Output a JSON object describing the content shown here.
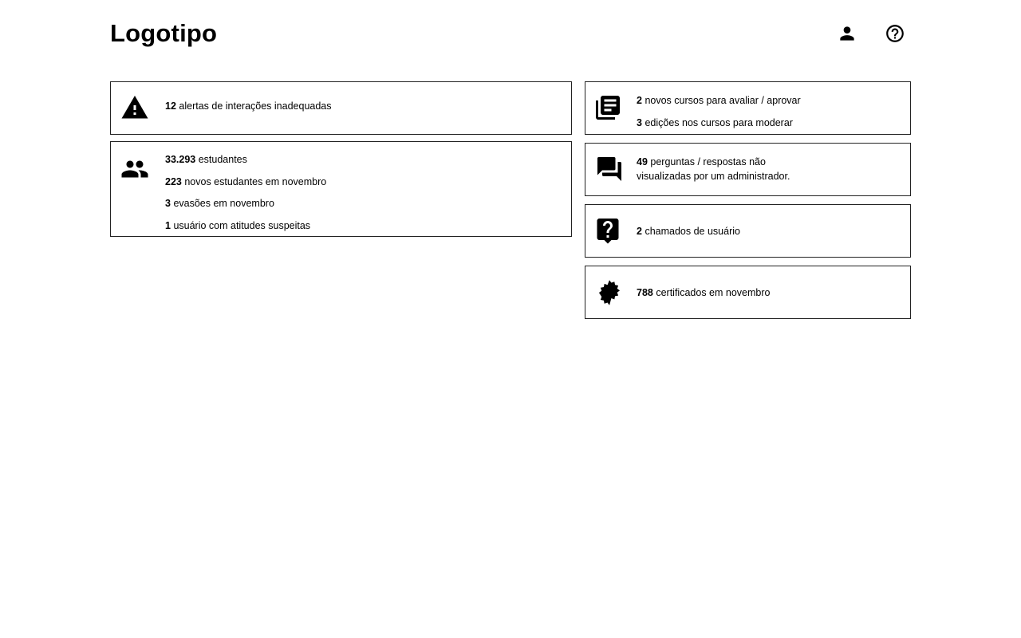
{
  "header": {
    "logo": "Logotipo",
    "user_icon": "person-icon",
    "help_icon": "help-circle-icon"
  },
  "alerts": {
    "icon": "warning-icon",
    "count": "12",
    "text": "alertas de interações inadequadas"
  },
  "students": {
    "icon": "group-icon",
    "rows": [
      {
        "count": "33.293",
        "text": "estudantes"
      },
      {
        "count": "223",
        "text": "novos estudantes em novembro"
      },
      {
        "count": "3",
        "text": "evasões em novembro"
      },
      {
        "count": "1",
        "text": "usuário com atitudes suspeitas"
      }
    ]
  },
  "courses": {
    "icon": "library-books-icon",
    "rows": [
      {
        "count": "2",
        "text": "novos cursos para avaliar / aprovar"
      },
      {
        "count": "3",
        "text": "edições nos cursos para moderar"
      }
    ]
  },
  "questions": {
    "icon": "forum-icon",
    "count": "49",
    "text_line1": "perguntas / respostas não",
    "text_line2": "visualizadas por um administrador."
  },
  "tickets": {
    "icon": "live-help-icon",
    "count": "2",
    "text": "chamados de usuário"
  },
  "certificates": {
    "icon": "certificate-seal-icon",
    "count": "788",
    "text": "certificados em novembro"
  }
}
